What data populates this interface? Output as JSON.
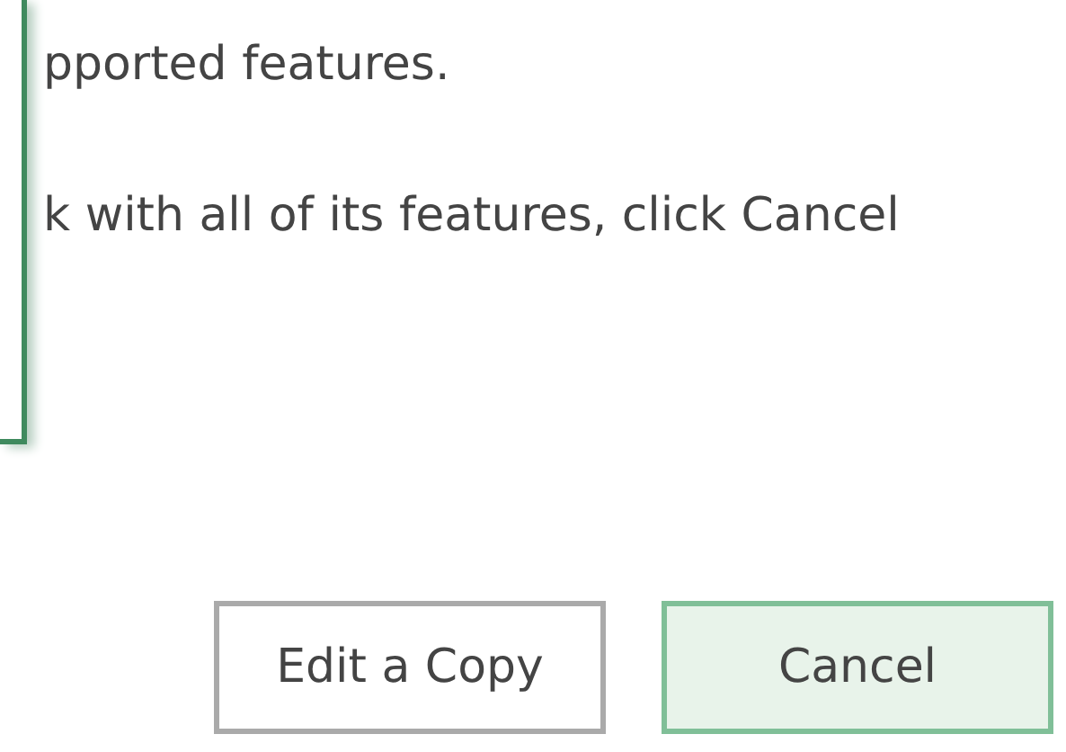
{
  "message": {
    "lines": [
      "pported features.",
      "k with all of its features, click Cancel"
    ]
  },
  "buttons": [
    {
      "label": "Edit a Copy",
      "kind": "secondary"
    },
    {
      "label": "Cancel",
      "kind": "primary"
    }
  ]
}
